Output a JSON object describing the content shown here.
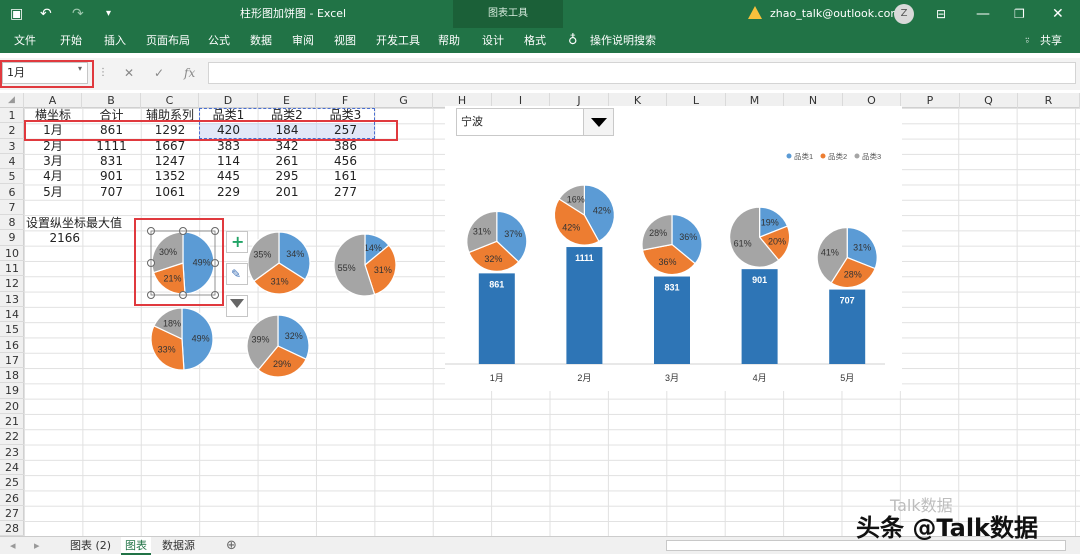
{
  "title_bar": {
    "doc_title": "柱形图加饼图 - Excel",
    "context_tab": "图表工具",
    "account": "zhao_talk@outlook.com",
    "avatar_letter": "Z",
    "share": "共享"
  },
  "ribbon": {
    "tabs": [
      "文件",
      "开始",
      "插入",
      "页面布局",
      "公式",
      "数据",
      "审阅",
      "视图",
      "开发工具",
      "帮助",
      "设计",
      "格式"
    ],
    "tell_me": "操作说明搜索"
  },
  "formula_bar": {
    "name_box": "1月",
    "formula": ""
  },
  "columns": [
    "A",
    "B",
    "C",
    "D",
    "E",
    "F",
    "G",
    "H",
    "I",
    "J",
    "K",
    "L",
    "M",
    "N",
    "O",
    "P",
    "Q",
    "R"
  ],
  "rows": [
    "1",
    "2",
    "3",
    "4",
    "5",
    "6",
    "7",
    "8",
    "9",
    "10",
    "11",
    "12",
    "13",
    "14",
    "15",
    "16",
    "17",
    "18",
    "19",
    "20",
    "21",
    "22",
    "23",
    "24",
    "25",
    "26",
    "27",
    "28"
  ],
  "table": {
    "headers": [
      "横坐标",
      "合计",
      "辅助系列",
      "品类1",
      "品类2",
      "品类3"
    ],
    "rows": [
      [
        "1月",
        "861",
        "1292",
        "420",
        "184",
        "257"
      ],
      [
        "2月",
        "1111",
        "1667",
        "383",
        "342",
        "386"
      ],
      [
        "3月",
        "831",
        "1247",
        "114",
        "261",
        "456"
      ],
      [
        "4月",
        "901",
        "1352",
        "445",
        "295",
        "161"
      ],
      [
        "5月",
        "707",
        "1061",
        "229",
        "201",
        "277"
      ]
    ],
    "max_label": "设置纵坐标最大值",
    "max_value": "2166"
  },
  "loose_pies": [
    {
      "slices": [
        0.49,
        0.21,
        0.3
      ],
      "labels": [
        "49%",
        "21%",
        "30%"
      ]
    },
    {
      "slices": [
        0.34,
        0.31,
        0.35
      ],
      "labels": [
        "34%",
        "31%",
        "35%"
      ]
    },
    {
      "slices": [
        0.14,
        0.31,
        0.55
      ],
      "labels": [
        "14%",
        "31%",
        "55%"
      ]
    },
    {
      "slices": [
        0.49,
        0.33,
        0.18
      ],
      "labels": [
        "49%",
        "33%",
        "18%"
      ]
    },
    {
      "slices": [
        0.32,
        0.29,
        0.39
      ],
      "labels": [
        "32%",
        "29%",
        "39%"
      ]
    }
  ],
  "chart_dropdown": "宁波",
  "chart_data": {
    "type": "bar",
    "categories": [
      "1月",
      "2月",
      "3月",
      "4月",
      "5月"
    ],
    "values": [
      861,
      1111,
      831,
      901,
      707
    ],
    "ylim": [
      0,
      2166
    ],
    "legend": [
      "品类1",
      "品类2",
      "品类3"
    ],
    "legend_position": "top-right",
    "bar_color": "#2e75b6",
    "pie_colors": [
      "#5b9bd5",
      "#ed7d31",
      "#a5a5a5"
    ],
    "pies": [
      {
        "labels": [
          "37%",
          "32%",
          "31%"
        ],
        "slices": [
          0.37,
          0.32,
          0.31
        ]
      },
      {
        "labels": [
          "42%",
          "42%",
          "16%"
        ],
        "slices": [
          0.42,
          0.42,
          0.16
        ]
      },
      {
        "labels": [
          "36%",
          "36%",
          "28%"
        ],
        "slices": [
          0.36,
          0.36,
          0.28
        ]
      },
      {
        "labels": [
          "19%",
          "20%",
          "61%"
        ],
        "slices": [
          0.19,
          0.2,
          0.61
        ]
      },
      {
        "labels": [
          "31%",
          "28%",
          "41%"
        ],
        "slices": [
          0.31,
          0.28,
          0.41
        ]
      }
    ]
  },
  "sheet_tabs": [
    "图表 (2)",
    "图表",
    "数据源"
  ],
  "watermark": "头条 @Talk数据",
  "watermark2": "Talk数据"
}
